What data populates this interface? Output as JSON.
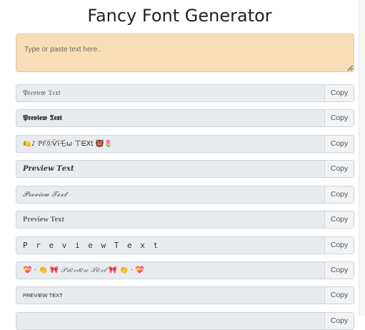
{
  "header": {
    "title": "Fancy Font Generator"
  },
  "input": {
    "placeholder": "Type or paste text here.."
  },
  "rows": [
    {
      "text": "𝔓𝔯𝔢𝔳𝔦𝔢𝔴 𝔗𝔢𝔵𝔱",
      "copy_label": "Copy"
    },
    {
      "text": "𝕻𝖗𝖊𝖛𝖎𝖊𝖜 𝕿𝖊𝖝𝖙",
      "copy_label": "Copy"
    },
    {
      "text": "🍋♪ ℙŕ⓪Ѷί乇ω ㄒᗴXt 👹🌷",
      "copy_label": "Copy"
    },
    {
      "text": "𝑷𝒓𝒆𝒗𝒊𝒆𝒘 𝑻𝒆𝒙𝒕",
      "copy_label": "Copy"
    },
    {
      "text": "𝓟𝓻𝓮𝓿𝓲𝓮𝔀 𝓣𝓮𝔁𝓽",
      "copy_label": "Copy"
    },
    {
      "text": "Preview Text",
      "copy_label": "Copy"
    },
    {
      "text": "P r e v i e w T e x t",
      "copy_label": "Copy"
    },
    {
      "prefix": "💝 · 👏 🎀 ",
      "text": "𝒫𝓇𝑒𝓋𝒾𝑒𝓌 𝒯𝑒𝓍𝓉",
      "suffix": " 🎀 👏 · 💝",
      "copy_label": "Copy"
    },
    {
      "text": "PREVIEW TEXT",
      "copy_label": "Copy"
    },
    {
      "text": "",
      "copy_label": "Copy"
    }
  ]
}
